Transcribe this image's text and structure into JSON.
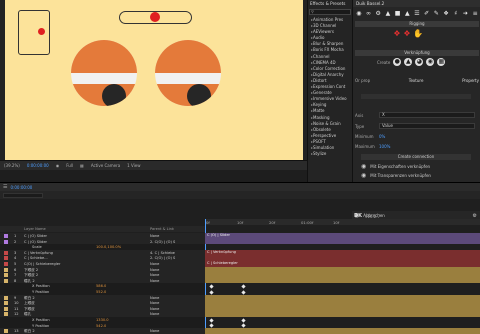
{
  "viewer": {
    "zoom": "(39.2%)",
    "timecode": "0:00:00:00",
    "quality": "Full",
    "camera": "Active Camera",
    "views": "1 View"
  },
  "effects_panel": {
    "title": "Effects & Presets",
    "search_value": "",
    "items": [
      "Animation Pres",
      "3D Channel",
      "AEViewers",
      "Audio",
      "Blur & Sharpen",
      "Boris FX Mocha",
      "Channel",
      "CINEMA 4D",
      "Color Correction",
      "Digital Anarchy",
      "Distort",
      "Expression Cont",
      "Generate",
      "Immersive Video",
      "Keying",
      "Matte",
      "Masking",
      "Noise & Grain",
      "Obsolete",
      "Perspective",
      "PSOFT",
      "Simulation",
      "Stylize"
    ]
  },
  "duik": {
    "title": "Duik Bassel.2",
    "sec_rigging": "Rigging",
    "sec_links": "Verknüpfung",
    "create_label": "Create",
    "field_label": "Or prop",
    "texture": "Texture",
    "property": "Property",
    "axis_label": "Axis",
    "axis_value": "X",
    "type_label": "Type",
    "type_value": "Value",
    "min_label": "Minimum",
    "min_value": "0%",
    "max_label": "Maximum",
    "max_value": "100%",
    "conn_header": "Create connection",
    "opt1": "Mit Eigenschaften verknüpfen",
    "opt2": "Mit Transparenzen verknüpfen",
    "cancel": "Abbrechen",
    "version": "v16.2.7"
  },
  "timeline": {
    "timecode": "0:00:00:00",
    "col_layer": "Layer Name",
    "col_parent": "Parent & Link",
    "ruler": [
      "0f",
      "10f",
      "20f",
      "01:00f",
      "10f"
    ],
    "rows": [
      {
        "num": "1",
        "name": "C | (O) Slider",
        "parent": "None",
        "color": "#b07ae0"
      },
      {
        "num": "2",
        "name": "C | (O) Slider",
        "parent": "2. C(O) | (O) S",
        "color": "#b07ae0"
      },
      {
        "num": "",
        "name": "Scale",
        "parent": "",
        "value": "100.0,100.0%",
        "prop": true
      },
      {
        "num": "3",
        "name": "C | Verknüpfung",
        "parent": "4. C | Schiebe",
        "color": "#c54848"
      },
      {
        "num": "4",
        "name": "C | Schiebe...",
        "parent": "2. C(O) | (O) S",
        "color": "#c54848"
      },
      {
        "num": "5",
        "name": "C(O) | Schieberegler",
        "parent": "None",
        "color": "#c54848"
      },
      {
        "num": "6",
        "name": "下眼皮 2",
        "parent": "None",
        "color": "#d7b46a"
      },
      {
        "num": "7",
        "name": "下眼皮 2",
        "parent": "None",
        "color": "#d7b46a"
      },
      {
        "num": "8",
        "name": "瞳孔 2",
        "parent": "None",
        "color": "#d7b46a"
      },
      {
        "num": "",
        "name": "X Position",
        "parent": "",
        "value": "586.0",
        "prop": true
      },
      {
        "num": "",
        "name": "Y Position",
        "parent": "",
        "value": "552.0",
        "prop": true
      },
      {
        "num": "9",
        "name": "眼白 2",
        "parent": "None",
        "color": "#d7b46a"
      },
      {
        "num": "10",
        "name": "上眼皮",
        "parent": "None",
        "color": "#d7b46a"
      },
      {
        "num": "11",
        "name": "下眼皮",
        "parent": "None",
        "color": "#d7b46a"
      },
      {
        "num": "12",
        "name": "瞳孔",
        "parent": "None",
        "color": "#d7b46a"
      },
      {
        "num": "",
        "name": "X Position",
        "parent": "",
        "value": "1330.0",
        "prop": true
      },
      {
        "num": "",
        "name": "Y Position",
        "parent": "",
        "value": "542.0",
        "prop": true
      },
      {
        "num": "13",
        "name": "眼白 2",
        "parent": "None",
        "color": "#d7b46a"
      }
    ],
    "bar_labels": [
      "C (O) | Slider",
      "C | Verknüpfung",
      "C | Schieberegler"
    ]
  }
}
